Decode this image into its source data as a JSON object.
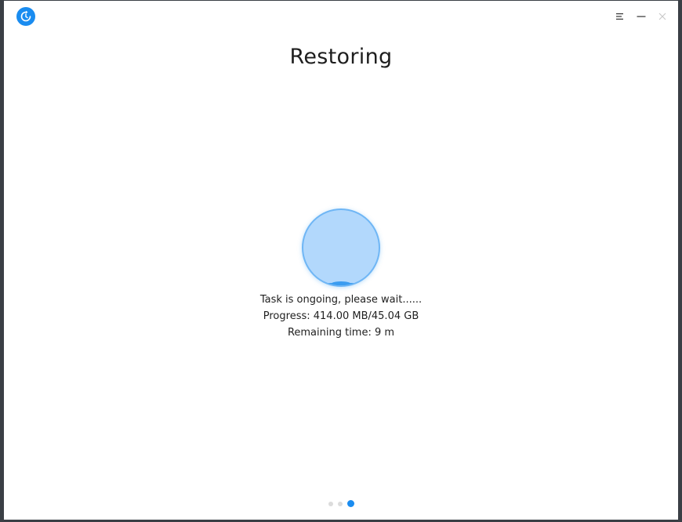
{
  "window": {
    "app_icon": "backup-restore-icon",
    "controls": [
      "menu-icon",
      "minimize-icon",
      "close-icon"
    ]
  },
  "page": {
    "title": "Restoring"
  },
  "progress": {
    "fraction": 0.009,
    "message": "Task is ongoing, please wait......",
    "progress_text": "Progress: 414.00 MB/45.04 GB",
    "remaining_text": "Remaining time: 9 m"
  },
  "pager": {
    "total": 3,
    "current": 3
  },
  "colors": {
    "accent": "#1a8cf0",
    "orb_fill": "#b2d8fc",
    "orb_border": "#6fb6f5"
  }
}
